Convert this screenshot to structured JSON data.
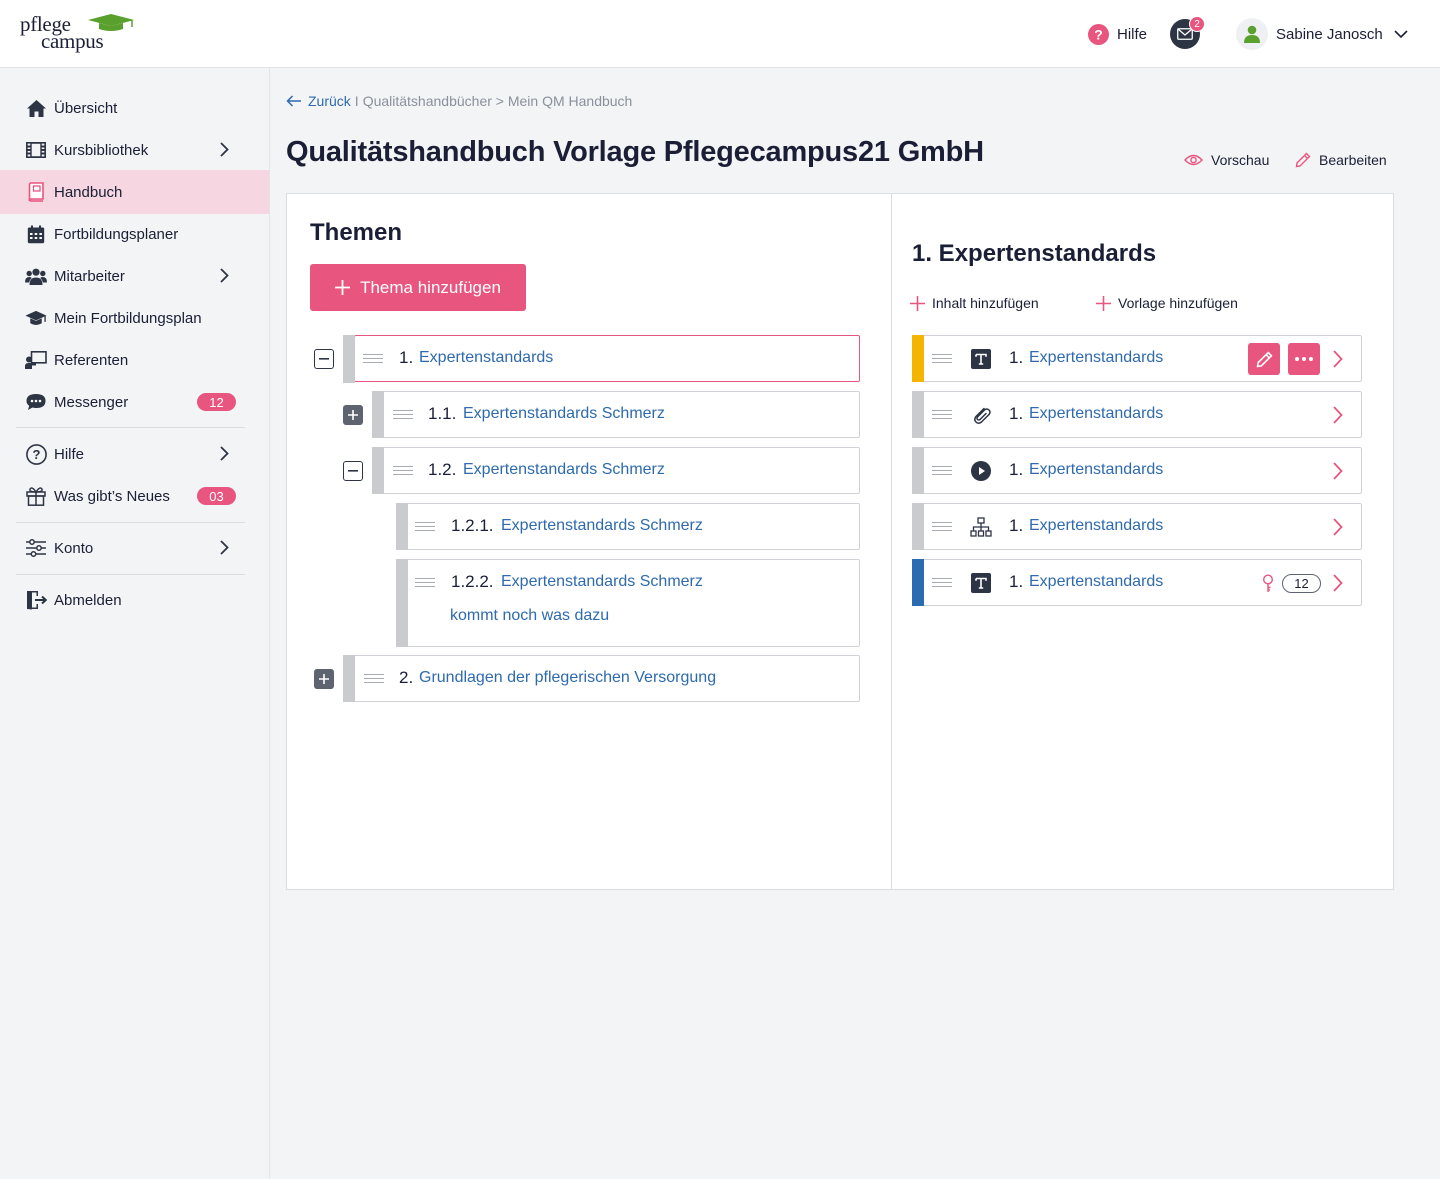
{
  "brand": {
    "line1": "pflege",
    "line2": "campus"
  },
  "header": {
    "help_label": "Hilfe",
    "mail_count": "2",
    "user_name": "Sabine Janosch"
  },
  "sidebar": {
    "items": [
      {
        "label": "Übersicht",
        "icon": "home-icon"
      },
      {
        "label": "Kursbibliothek",
        "icon": "film-icon"
      },
      {
        "label": "Handbuch",
        "icon": "book-icon"
      },
      {
        "label": "Fortbildungsplaner",
        "icon": "calendar-icon"
      },
      {
        "label": "Mitarbeiter",
        "icon": "users-icon"
      },
      {
        "label": "Mein Fortbildungsplan",
        "icon": "graduation-cap-icon"
      },
      {
        "label": "Referenten",
        "icon": "presenter-icon"
      },
      {
        "label": "Messenger",
        "icon": "chat-icon",
        "badge": "12"
      },
      {
        "label": "Hilfe",
        "icon": "help-circle-icon"
      },
      {
        "label": "Was gibt’s Neues",
        "icon": "gift-icon",
        "badge": "03"
      },
      {
        "label": "Konto",
        "icon": "sliders-icon"
      },
      {
        "label": "Abmelden",
        "icon": "logout-icon"
      }
    ]
  },
  "breadcrumb": {
    "back": "Zurück",
    "divider": "I",
    "path": "Qualitätshandbücher > Mein QM Handbuch"
  },
  "page": {
    "title": "Qualitätshandbuch Vorlage Pflegecampus21 GmbH",
    "preview_label": "Vorschau",
    "edit_label": "Bearbeiten"
  },
  "themes": {
    "heading": "Themen",
    "add_button": "Thema hinzufügen",
    "tree": [
      {
        "num": "1.",
        "label": "Expertenstandards"
      },
      {
        "num": "1.1.",
        "label": "Expertenstandards Schmerz"
      },
      {
        "num": "1.2.",
        "label": "Expertenstandards Schmerz"
      },
      {
        "num": "1.2.1.",
        "label": "Expertenstandards Schmerz"
      },
      {
        "num": "1.2.2.",
        "label": "Expertenstandards Schmerz",
        "note": "kommt noch was dazu"
      },
      {
        "num": "2.",
        "label": "Grundlagen der pflegerischen Versorgung"
      }
    ]
  },
  "detail": {
    "heading": "1. Expertenstandards",
    "add_content": "Inhalt hinzufügen",
    "add_template": "Vorlage hinzufügen",
    "items": [
      {
        "num": "1.",
        "label": "Expertenstandards",
        "icon": "text-icon",
        "accent": "#f5b400"
      },
      {
        "num": "1.",
        "label": "Expertenstandards",
        "icon": "paperclip-icon"
      },
      {
        "num": "1.",
        "label": "Expertenstandards",
        "icon": "play-icon"
      },
      {
        "num": "1.",
        "label": "Expertenstandards",
        "icon": "sitemap-icon"
      },
      {
        "num": "1.",
        "label": "Expertenstandards",
        "icon": "text-icon",
        "accent": "#2b6cb0",
        "count": "12"
      }
    ]
  },
  "colors": {
    "accent": "#e8557f",
    "link": "#2e6aad",
    "dark": "#1a1f36"
  }
}
